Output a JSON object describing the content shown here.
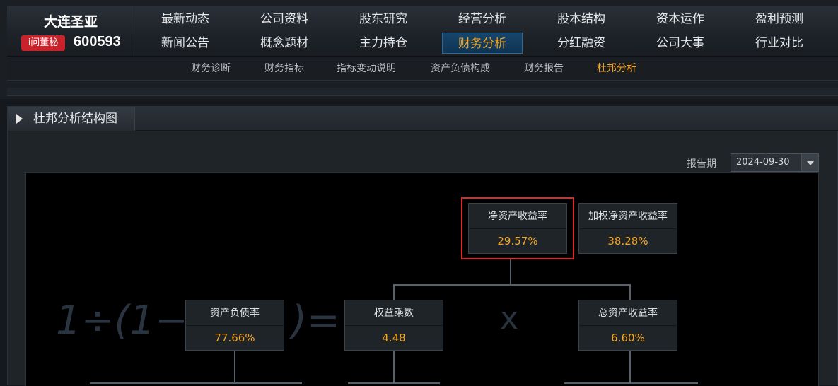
{
  "stock": {
    "name": "大连圣亚",
    "code": "600593",
    "ask_button": "i问董秘"
  },
  "nav": {
    "row1": [
      "最新动态",
      "公司资料",
      "股东研究",
      "经营分析",
      "股本结构",
      "资本运作",
      "盈利预测"
    ],
    "row2": [
      "新闻公告",
      "概念题材",
      "主力持仓",
      "财务分析",
      "分红融资",
      "公司大事",
      "行业对比"
    ],
    "active": "财务分析"
  },
  "subnav": {
    "items": [
      "财务诊断",
      "财务指标",
      "指标变动说明",
      "资产负债构成",
      "财务报告",
      "杜邦分析"
    ],
    "active": "杜邦分析"
  },
  "panel": {
    "title": "杜邦分析结构图"
  },
  "period": {
    "label": "报告期",
    "value": "2024-09-30"
  },
  "dupont": {
    "roe": {
      "label": "净资产收益率",
      "value": "29.57%"
    },
    "weighted_roe": {
      "label": "加权净资产收益率",
      "value": "38.28%"
    },
    "debt_ratio": {
      "label": "资产负债率",
      "value": "77.66%"
    },
    "equity_multiplier": {
      "label": "权益乘数",
      "value": "4.48"
    },
    "roa": {
      "label": "总资产收益率",
      "value": "6.60%"
    }
  },
  "formula": {
    "left": "1÷(1−",
    "right": ")=",
    "times": "x"
  },
  "colors": {
    "accent": "#f5a623",
    "highlight": "#e02828",
    "active_nav": "#0f3454"
  }
}
